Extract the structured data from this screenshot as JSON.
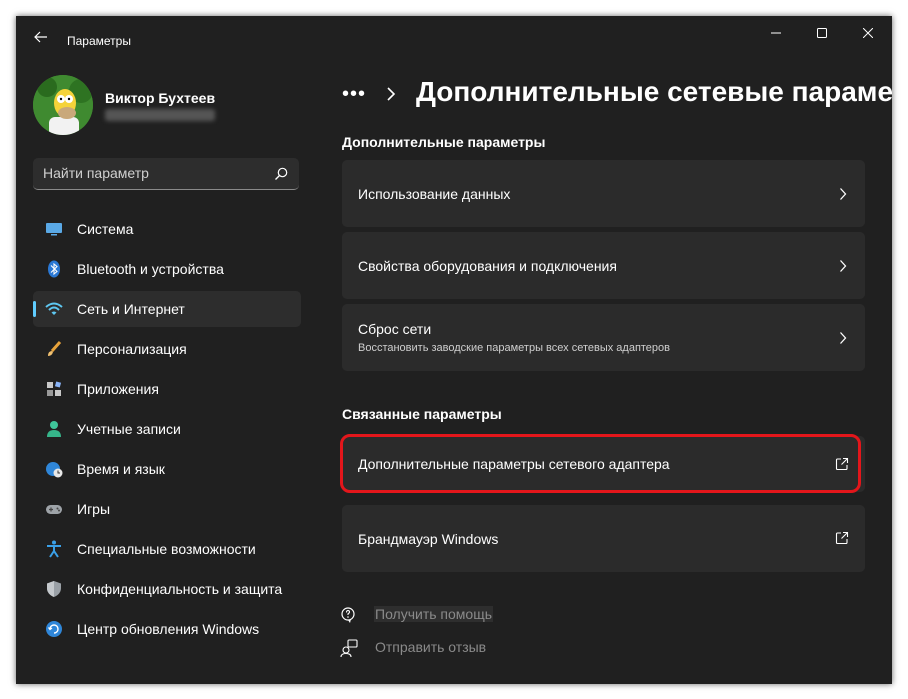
{
  "app": {
    "title": "Параметры"
  },
  "user": {
    "name": "Виктор Бухтеев"
  },
  "search": {
    "placeholder": "Найти параметр"
  },
  "nav": {
    "items": [
      {
        "label": "Система",
        "icon": "display-icon"
      },
      {
        "label": "Bluetooth и устройства",
        "icon": "bluetooth-icon"
      },
      {
        "label": "Сеть и Интернет",
        "icon": "wifi-icon",
        "active": true
      },
      {
        "label": "Персонализация",
        "icon": "brush-icon"
      },
      {
        "label": "Приложения",
        "icon": "apps-icon"
      },
      {
        "label": "Учетные записи",
        "icon": "person-icon"
      },
      {
        "label": "Время и язык",
        "icon": "globe-clock-icon"
      },
      {
        "label": "Игры",
        "icon": "gamepad-icon"
      },
      {
        "label": "Специальные возможности",
        "icon": "accessibility-icon"
      },
      {
        "label": "Конфиденциальность и защита",
        "icon": "shield-icon"
      },
      {
        "label": "Центр обновления Windows",
        "icon": "update-icon"
      }
    ]
  },
  "breadcrumb": {
    "more": "•••",
    "title": "Дополнительные сетевые параметры"
  },
  "sections": {
    "advanced": {
      "heading": "Дополнительные параметры",
      "cards": [
        {
          "title": "Использование данных"
        },
        {
          "title": "Свойства оборудования и подключения"
        },
        {
          "title": "Сброс сети",
          "subtitle": "Восстановить заводские параметры всех сетевых адаптеров"
        }
      ]
    },
    "related": {
      "heading": "Связанные параметры",
      "cards": [
        {
          "title": "Дополнительные параметры сетевого адаптера"
        },
        {
          "title": "Брандмауэр Windows"
        }
      ]
    }
  },
  "footer": {
    "help": "Получить помощь",
    "feedback": "Отправить отзыв"
  },
  "colors": {
    "accent": "#60cdff",
    "highlight": "#e3161b",
    "background": "#202020",
    "card": "#2b2b2b"
  }
}
